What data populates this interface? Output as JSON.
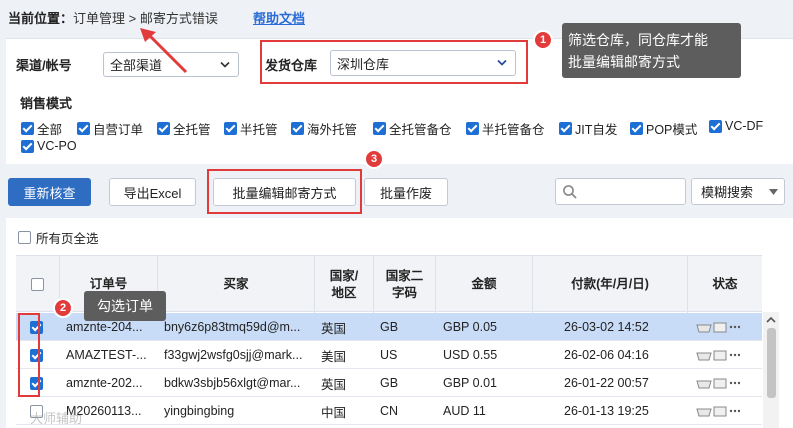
{
  "breadcrumb": {
    "label": "当前位置：",
    "path1": "订单管理",
    "sep": ">",
    "path2": "邮寄方式错误"
  },
  "help_link": "帮助文档",
  "filters": {
    "channel_label": "渠道/帐号",
    "channel_value": "全部渠道",
    "warehouse_label": "发货仓库",
    "warehouse_value": "深圳仓库",
    "sales_mode_label": "销售模式",
    "sales_modes": [
      "全部",
      "自营订单",
      "全托管",
      "半托管",
      "海外托管",
      "全托管备仓",
      "半托管备仓",
      "JIT自发",
      "POP模式",
      "VC-DF",
      "VC-PO"
    ]
  },
  "toolbar": {
    "recheck": "重新核查",
    "export_excel": "导出Excel",
    "batch_edit_shipping": "批量编辑邮寄方式",
    "batch_void": "批量作废",
    "search_mode": "模糊搜索"
  },
  "select_all_pages": "所有页全选",
  "table": {
    "headers": {
      "order_no": "订单号",
      "buyer": "买家",
      "country": "国家/地区",
      "country_code": "国家二字码",
      "amount": "金额",
      "paid_at": "付款(年/月/日)",
      "status": "状态"
    },
    "rows": [
      {
        "checked": true,
        "order_no": "amznte-204...",
        "buyer": "bny6z6p83tmq59d@m...",
        "country": "英国",
        "code": "GB",
        "amount": "GBP 0.05",
        "paid": "26-03-02 14:52"
      },
      {
        "checked": true,
        "order_no": "AMAZTEST-...",
        "buyer": "f33gwj2wsfg0sjj@mark...",
        "country": "美国",
        "code": "US",
        "amount": "USD 0.55",
        "paid": "26-02-06 04:16"
      },
      {
        "checked": true,
        "order_no": "amznte-202...",
        "buyer": "bdkw3sbjb56xlgt@mar...",
        "country": "英国",
        "code": "GB",
        "amount": "GBP 0.01",
        "paid": "26-01-22 00:57"
      },
      {
        "checked": false,
        "order_no": "M20260113...",
        "buyer": "yingbingbing",
        "country": "中国",
        "code": "CN",
        "amount": "AUD 11",
        "paid": "26-01-13 19:25"
      }
    ]
  },
  "annotations": {
    "step1_num": "1",
    "step1_line1": "筛选仓库，同仓库才能",
    "step1_line2": "批量编辑邮寄方式",
    "step2_num": "2",
    "step2_text": "勾选订单",
    "step3_num": "3"
  },
  "watermark": "大师辅助"
}
